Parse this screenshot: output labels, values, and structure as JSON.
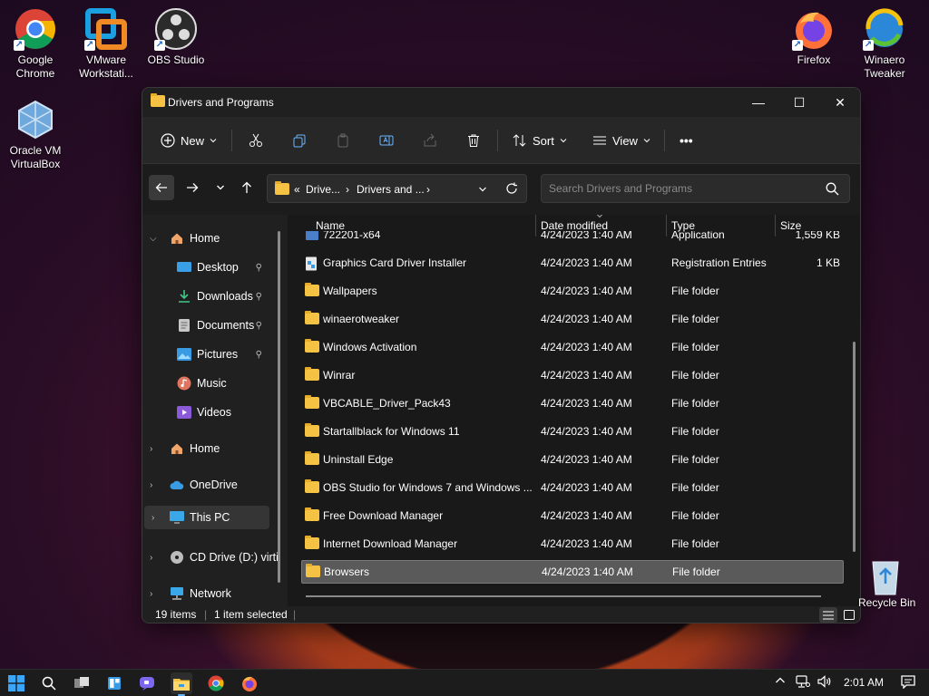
{
  "desktop": {
    "icons": [
      {
        "label": "Google Chrome"
      },
      {
        "label": "VMware Workstati..."
      },
      {
        "label": "OBS Studio"
      },
      {
        "label": "Firefox"
      },
      {
        "label": "Winaero Tweaker"
      },
      {
        "label": "Oracle VM VirtualBox"
      }
    ],
    "recycle_bin": "Recycle Bin"
  },
  "window": {
    "title": "Drivers and Programs",
    "toolbar": {
      "new_label": "New",
      "sort_label": "Sort",
      "view_label": "View",
      "more_label": "•••"
    },
    "address": {
      "prefix": "«",
      "crumb1": "Drive...",
      "sep": "›",
      "crumb2": "Drivers and ...",
      "sep2": "›"
    },
    "search": {
      "placeholder": "Search Drivers and Programs"
    },
    "nav": {
      "items": [
        {
          "label": "Home"
        },
        {
          "label": "Desktop"
        },
        {
          "label": "Downloads"
        },
        {
          "label": "Documents"
        },
        {
          "label": "Pictures"
        },
        {
          "label": "Music"
        },
        {
          "label": "Videos"
        },
        {
          "label": "Home"
        },
        {
          "label": "OneDrive"
        },
        {
          "label": "This PC"
        },
        {
          "label": "CD Drive (D:) virti"
        },
        {
          "label": "Network"
        }
      ]
    },
    "columns": {
      "name": "Name",
      "date": "Date modified",
      "type": "Type",
      "size": "Size"
    },
    "files": [
      {
        "name": "722201-x64",
        "date": "4/24/2023 1:40 AM",
        "type": "Application",
        "size": "1,559 KB"
      },
      {
        "name": "Graphics Card Driver Installer",
        "date": "4/24/2023 1:40 AM",
        "type": "Registration Entries",
        "size": "1 KB"
      },
      {
        "name": "Wallpapers",
        "date": "4/24/2023 1:40 AM",
        "type": "File folder",
        "size": ""
      },
      {
        "name": "winaerotweaker",
        "date": "4/24/2023 1:40 AM",
        "type": "File folder",
        "size": ""
      },
      {
        "name": "Windows Activation",
        "date": "4/24/2023 1:40 AM",
        "type": "File folder",
        "size": ""
      },
      {
        "name": "Winrar",
        "date": "4/24/2023 1:40 AM",
        "type": "File folder",
        "size": ""
      },
      {
        "name": "VBCABLE_Driver_Pack43",
        "date": "4/24/2023 1:40 AM",
        "type": "File folder",
        "size": ""
      },
      {
        "name": "Startallblack for Windows 11",
        "date": "4/24/2023 1:40 AM",
        "type": "File folder",
        "size": ""
      },
      {
        "name": "Uninstall Edge",
        "date": "4/24/2023 1:40 AM",
        "type": "File folder",
        "size": ""
      },
      {
        "name": "OBS Studio for Windows 7 and Windows ...",
        "date": "4/24/2023 1:40 AM",
        "type": "File folder",
        "size": ""
      },
      {
        "name": "Free Download Manager",
        "date": "4/24/2023 1:40 AM",
        "type": "File folder",
        "size": ""
      },
      {
        "name": "Internet Download Manager",
        "date": "4/24/2023 1:40 AM",
        "type": "File folder",
        "size": ""
      },
      {
        "name": "Browsers",
        "date": "4/24/2023 1:40 AM",
        "type": "File folder",
        "size": ""
      }
    ],
    "status": {
      "items": "19 items",
      "selected": "1 item selected"
    }
  },
  "taskbar": {
    "time": "2:01 AM"
  },
  "colors": {
    "accent": "#5fb2ff",
    "folder": "#f5c243",
    "selected_row": "#5a5a5a"
  }
}
